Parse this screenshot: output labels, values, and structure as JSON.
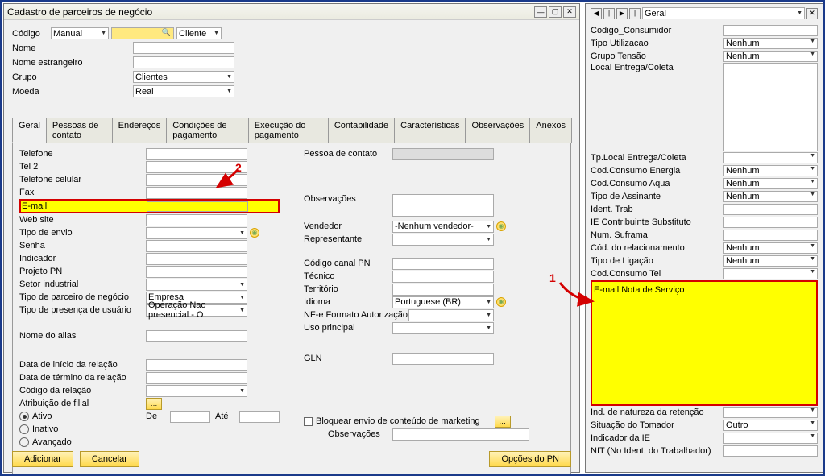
{
  "window": {
    "title": "Cadastro de parceiros de negócio"
  },
  "header": {
    "codigo_label": "Código",
    "codigo_mode": "Manual",
    "codigo_type": "Cliente",
    "nome_label": "Nome",
    "nome_estr_label": "Nome estrangeiro",
    "grupo_label": "Grupo",
    "grupo_value": "Clientes",
    "moeda_label": "Moeda",
    "moeda_value": "Real"
  },
  "tabs": {
    "t0": "Geral",
    "t1": "Pessoas de contato",
    "t2": "Endereços",
    "t3": "Condições de pagamento",
    "t4": "Execução do pagamento",
    "t5": "Contabilidade",
    "t6": "Características",
    "t7": "Observações",
    "t8": "Anexos"
  },
  "left": {
    "telefone": "Telefone",
    "tel2": "Tel 2",
    "celular": "Telefone celular",
    "fax": "Fax",
    "email": "E-mail",
    "website": "Web site",
    "tipo_envio": "Tipo de envio",
    "senha": "Senha",
    "indicador": "Indicador",
    "projeto": "Projeto PN",
    "setor": "Setor industrial",
    "tipo_parceiro": "Tipo de parceiro de negócio",
    "tipo_parceiro_val": "Empresa",
    "tipo_presenca": "Tipo de presença de usuário",
    "tipo_presenca_val": "Operação Nao presencial - O",
    "nome_alias": "Nome do alias",
    "data_inicio": "Data de início da relação",
    "data_termino": "Data de término da relação",
    "codigo_relacao": "Código da relação",
    "atrib_filial": "Atribuição de filial",
    "ativo": "Ativo",
    "inativo": "Inativo",
    "avancado": "Avançado",
    "de": "De",
    "ate": "Até",
    "obs2": "Observações"
  },
  "right": {
    "pessoa_contato": "Pessoa de contato",
    "obs": "Observações",
    "vendedor": "Vendedor",
    "vendedor_val": "-Nenhum vendedor-",
    "representante": "Representante",
    "codigo_canal": "Código canal PN",
    "tecnico": "Técnico",
    "territorio": "Território",
    "idioma": "Idioma",
    "idioma_val": "Portuguese (BR)",
    "nfe": "NF-e Formato Autorização",
    "uso_principal": "Uso principal",
    "gln": "GLN",
    "bloquear": "Bloquear envio de conteúdo de marketing"
  },
  "footer": {
    "adicionar": "Adicionar",
    "cancelar": "Cancelar",
    "opcoes": "Opções do PN"
  },
  "side_title": "Geral",
  "side": {
    "cod_cons": "Codigo_Consumidor",
    "tipo_util": "Tipo Utilizacao",
    "grupo_tensao": "Grupo Tensão",
    "local_entrega": "Local Entrega/Coleta",
    "tp_local": "Tp.Local Entrega/Coleta",
    "cod_energia": "Cod.Consumo Energia",
    "cod_agua": "Cod.Consumo Aqua",
    "tipo_assinante": "Tipo de Assinante",
    "ident_trab": "Ident. Trab",
    "ie_contrib": "IE Contribuinte Substituto",
    "num_suframa": "Num. Suframa",
    "cod_relac": "Cód. do relacionamento",
    "tipo_ligacao": "Tipo de Ligação",
    "cod_tel": "Cod.Consumo Tel",
    "email_nota": "E-mail Nota de Serviço",
    "ind_natureza": "Ind. de natureza da retenção",
    "sit_tomador": "Situação do Tomador",
    "indicador_ie": "Indicador da IE",
    "nit": "NIT (No Ident. do Trabalhador)",
    "nenhum": "Nenhum",
    "outro": "Outro"
  },
  "ann": {
    "n1": "1",
    "n2": "2"
  }
}
